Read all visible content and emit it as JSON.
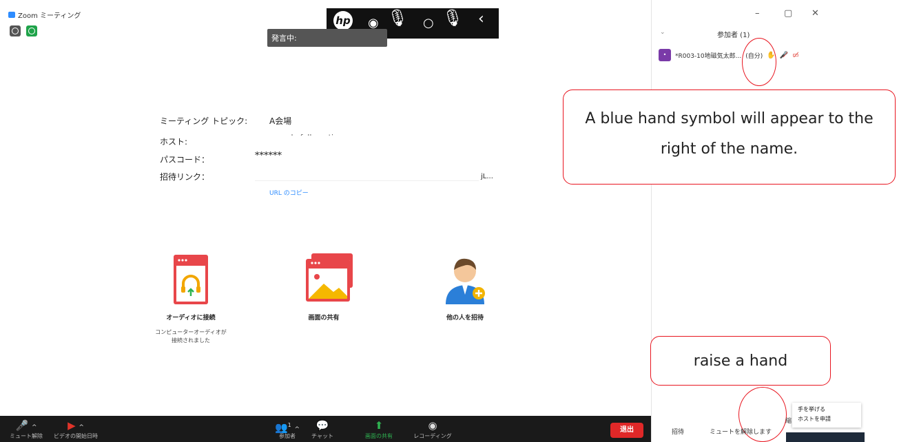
{
  "window": {
    "title": "Zoom ミーティング",
    "minimize": "–",
    "maximize": "▢",
    "close": "✕"
  },
  "overlay": {
    "hp_logo": "hp",
    "speaking_label": "発言中:"
  },
  "meeting_info": {
    "topic_label": "ミーティング トピック:",
    "topic_value": "A会場",
    "host_label": "ホスト:",
    "host_value": "agenda fallmeeting",
    "passcode_label": "パスコード：",
    "passcode_value": "******",
    "invite_label": "招待リンク：",
    "invite_value": "jL...",
    "copy_url": "URL のコピー"
  },
  "actions": [
    {
      "label": "オーディオに接続",
      "sub": "コンピューターオーディオが接続されました"
    },
    {
      "label": "画面の共有"
    },
    {
      "label": "他の人を招待"
    }
  ],
  "participants_panel": {
    "title": "参加者 (1)",
    "participant": {
      "avatar": "•",
      "name": "*R003-10地磁気太郎...",
      "self_tag": "(自分)"
    },
    "invite_button": "招待",
    "unmute_button": "ミュートを解除します",
    "popup_items": [
      "手を挙げる",
      "ホストを申請"
    ],
    "partial_label": "縮"
  },
  "callouts": {
    "hand_note": "A blue hand symbol will appear to the right of the name.",
    "raise_note": "raise a hand"
  },
  "toolbar": {
    "unmute": "ミュート解除",
    "video": "ビデオの開始日時",
    "participants": "参加者",
    "participant_count": "1",
    "chat": "チャット",
    "share": "画面の共有",
    "record": "レコーディング",
    "leave": "退出"
  },
  "colors": {
    "accent_blue": "#2d8cff",
    "callout_red": "#e8141e",
    "leave_red": "#e02828",
    "share_green": "#2fb351"
  }
}
